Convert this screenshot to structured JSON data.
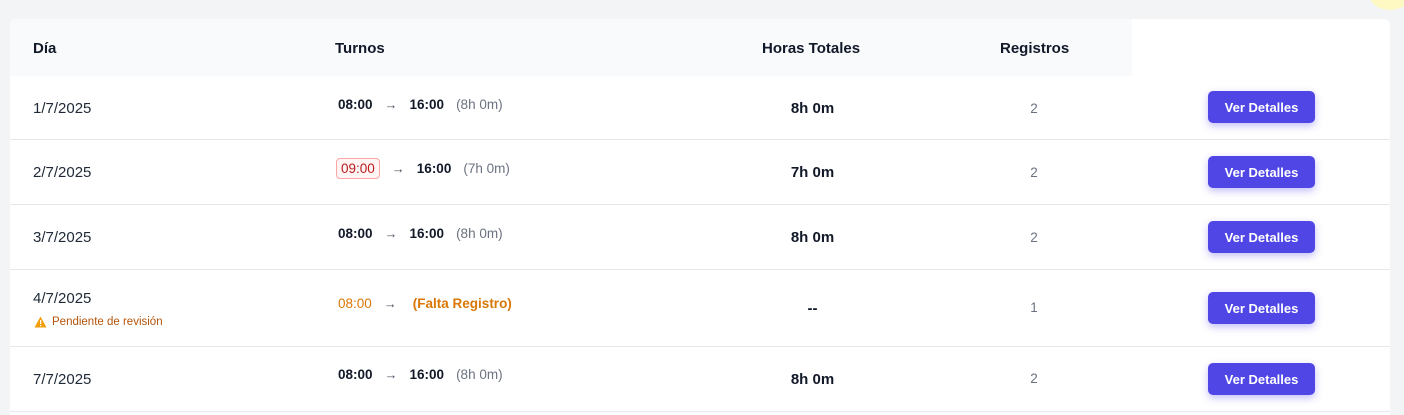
{
  "table": {
    "headers": {
      "day": "Día",
      "shifts": "Turnos",
      "total_hours": "Horas Totales",
      "records": "Registros"
    },
    "rows": [
      {
        "day": "1/7/2025",
        "start": "08:00",
        "arrow": "→",
        "end": "16:00",
        "duration": "(8h 0m)",
        "total": "8h 0m",
        "records": "2",
        "action": "Ver Detalles"
      },
      {
        "day": "2/7/2025",
        "start": "09:00",
        "arrow": "→",
        "end": "16:00",
        "duration": "(7h 0m)",
        "total": "7h 0m",
        "records": "2",
        "action": "Ver Detalles"
      },
      {
        "day": "3/7/2025",
        "start": "08:00",
        "arrow": "→",
        "end": "16:00",
        "duration": "(8h 0m)",
        "total": "8h 0m",
        "records": "2",
        "action": "Ver Detalles"
      },
      {
        "day": "4/7/2025",
        "status": "Pendiente de revisión",
        "start": "08:00",
        "arrow": "→",
        "end": "(Falta Registro)",
        "total": "--",
        "records": "1",
        "action": "Ver Detalles"
      },
      {
        "day": "7/7/2025",
        "start": "08:00",
        "arrow": "→",
        "end": "16:00",
        "duration": "(8h 0m)",
        "total": "8h 0m",
        "records": "2",
        "action": "Ver Detalles"
      }
    ]
  },
  "colors": {
    "accent": "#4f46e5",
    "late": "#b91c1c",
    "warning": "#d97706"
  },
  "icons": {
    "warning": "warning-icon",
    "arrow": "arrow-right"
  }
}
